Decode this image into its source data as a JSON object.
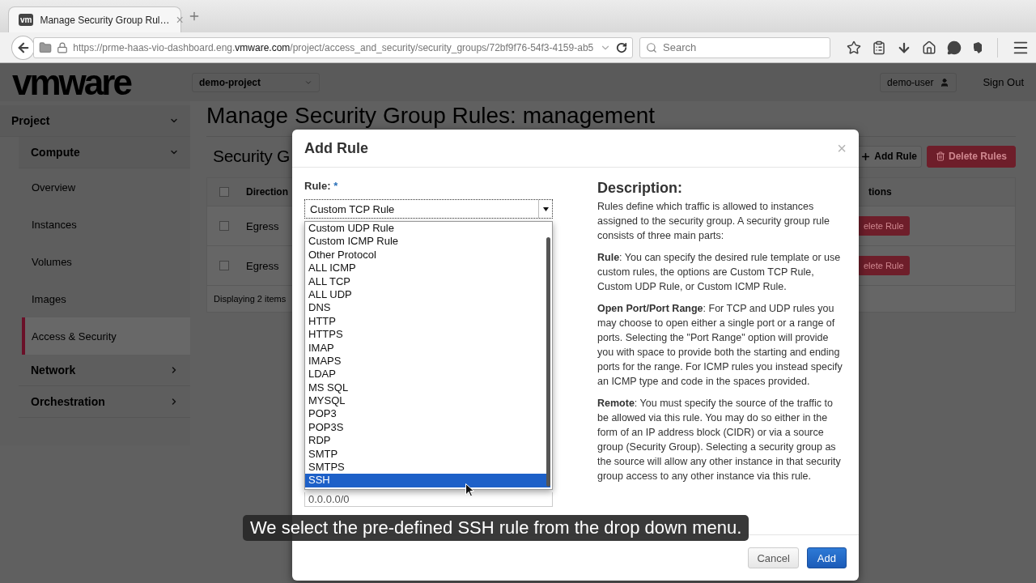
{
  "browser": {
    "tab": {
      "badge": "vm",
      "title": "Manage Security Group Rul…",
      "close": "×"
    },
    "url": {
      "scheme_host": "https://prme-haas-vio-dashboard.eng.",
      "domain": "vmware.com",
      "path": "/project/access_and_security/security_groups/72bf9f76-54f3-4159-ab5"
    },
    "search": {
      "placeholder": "Search"
    }
  },
  "header": {
    "logo": "vmware",
    "project": "demo-project",
    "user": "demo-user",
    "sign_out": "Sign Out"
  },
  "sidebar": {
    "sections": [
      {
        "label": "Project",
        "expanded": true,
        "children": [
          {
            "label": "Compute",
            "expanded": true,
            "children": [
              {
                "label": "Overview",
                "selected": false
              },
              {
                "label": "Instances",
                "selected": false
              },
              {
                "label": "Volumes",
                "selected": false
              },
              {
                "label": "Images",
                "selected": false
              },
              {
                "label": "Access & Security",
                "selected": true
              }
            ]
          },
          {
            "label": "Network",
            "expanded": false
          },
          {
            "label": "Orchestration",
            "expanded": false
          }
        ]
      }
    ]
  },
  "main": {
    "title": "Manage Security Group Rules: management",
    "panel_title": "Security G",
    "buttons": [
      {
        "label": "Add Rule",
        "kind": "default"
      },
      {
        "label": "Delete Rules",
        "kind": "danger"
      }
    ],
    "table": {
      "all_checked": false,
      "columns": [
        "Direction",
        "tions"
      ],
      "rows": [
        {
          "checked": false,
          "direction": "Egress",
          "action": "elete Rule"
        },
        {
          "checked": false,
          "direction": "Egress",
          "action": "elete Rule"
        }
      ],
      "footer": "Displaying 2 items"
    }
  },
  "modal": {
    "title": "Add Rule",
    "close": "×",
    "field_label": "Rule:",
    "required_mark": "*",
    "select_value": "Custom TCP Rule",
    "options": [
      {
        "label": "Custom UDP Rule",
        "selected": false
      },
      {
        "label": "Custom ICMP Rule",
        "selected": false
      },
      {
        "label": "Other Protocol",
        "selected": false
      },
      {
        "label": "ALL ICMP",
        "selected": false
      },
      {
        "label": "ALL TCP",
        "selected": false
      },
      {
        "label": "ALL UDP",
        "selected": false
      },
      {
        "label": "DNS",
        "selected": false
      },
      {
        "label": "HTTP",
        "selected": false
      },
      {
        "label": "HTTPS",
        "selected": false
      },
      {
        "label": "IMAP",
        "selected": false
      },
      {
        "label": "IMAPS",
        "selected": false
      },
      {
        "label": "LDAP",
        "selected": false
      },
      {
        "label": "MS SQL",
        "selected": false
      },
      {
        "label": "MYSQL",
        "selected": false
      },
      {
        "label": "POP3",
        "selected": false
      },
      {
        "label": "POP3S",
        "selected": false
      },
      {
        "label": "RDP",
        "selected": false
      },
      {
        "label": "SMTP",
        "selected": false
      },
      {
        "label": "SMTPS",
        "selected": false
      },
      {
        "label": "SSH",
        "selected": true
      }
    ],
    "remote_value": "0.0.0.0/0",
    "description_title": "Description:",
    "paragraphs": [
      "Rules define which traffic is allowed to instances assigned to the security group. A security group rule consists of three main parts:",
      "**Rule**: You can specify the desired rule template or use custom rules, the options are Custom TCP Rule, Custom UDP Rule, or Custom ICMP Rule.",
      "**Open Port/Port Range**: For TCP and UDP rules you may choose to open either a single port or a range of ports. Selecting the \"Port Range\" option will provide you with space to provide both the starting and ending ports for the range. For ICMP rules you instead specify an ICMP type and code in the spaces provided.",
      "**Remote**: You must specify the source of the traffic to be allowed via this rule. You may do so either in the form of an IP address block (CIDR) or via a source group (Security Group). Selecting a security group as the source will allow any other instance in that security group access to any other instance via this rule."
    ],
    "buttons": [
      {
        "label": "Cancel",
        "kind": "default"
      },
      {
        "label": "Add",
        "kind": "primary"
      }
    ]
  },
  "caption": "We select the pre-defined SSH rule from the drop down menu."
}
